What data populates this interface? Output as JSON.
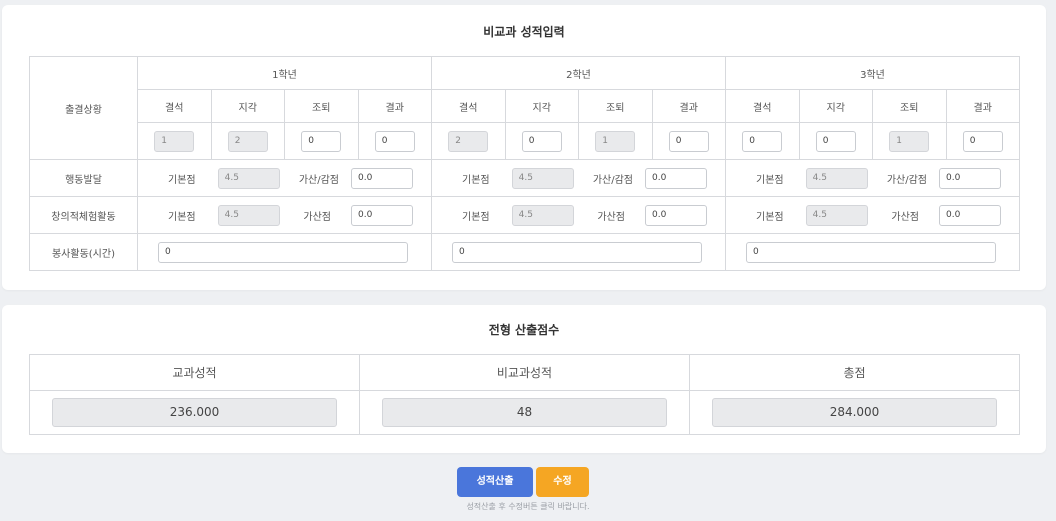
{
  "non_subject": {
    "title": "비교과 성적입력",
    "attendance_label": "출결상황",
    "behavior_label": "행동발달",
    "creative_label": "창의적체험활동",
    "volunteer_label": "봉사활동(시간)",
    "base_label": "기본점",
    "add_sub_label": "가산/감점",
    "add_label": "가산점",
    "attendance_cols": [
      "결석",
      "지각",
      "조퇴",
      "결과"
    ],
    "years": [
      {
        "label": "1학년",
        "attendance": [
          "1",
          "2",
          "0",
          "0"
        ],
        "behavior_base": "4.5",
        "behavior_add": "0.0",
        "creative_base": "4.5",
        "creative_add": "0.0",
        "volunteer": "0"
      },
      {
        "label": "2학년",
        "attendance": [
          "2",
          "0",
          "1",
          "0"
        ],
        "behavior_base": "4.5",
        "behavior_add": "0.0",
        "creative_base": "4.5",
        "creative_add": "0.0",
        "volunteer": "0"
      },
      {
        "label": "3학년",
        "attendance": [
          "0",
          "0",
          "1",
          "0"
        ],
        "behavior_base": "4.5",
        "behavior_add": "0.0",
        "creative_base": "4.5",
        "creative_add": "0.0",
        "volunteer": "0"
      }
    ]
  },
  "scores": {
    "title": "전형 산출점수",
    "headers": [
      "교과성적",
      "비교과성적",
      "총점"
    ],
    "values": [
      "236.000",
      "48",
      "284.000"
    ]
  },
  "actions": {
    "calc_label": "성적산출",
    "edit_label": "수정",
    "hint": "성적산출 후 수정버튼 클릭 바랍니다."
  },
  "colors": {
    "primary": "#4a76db",
    "warning": "#f5a623"
  }
}
